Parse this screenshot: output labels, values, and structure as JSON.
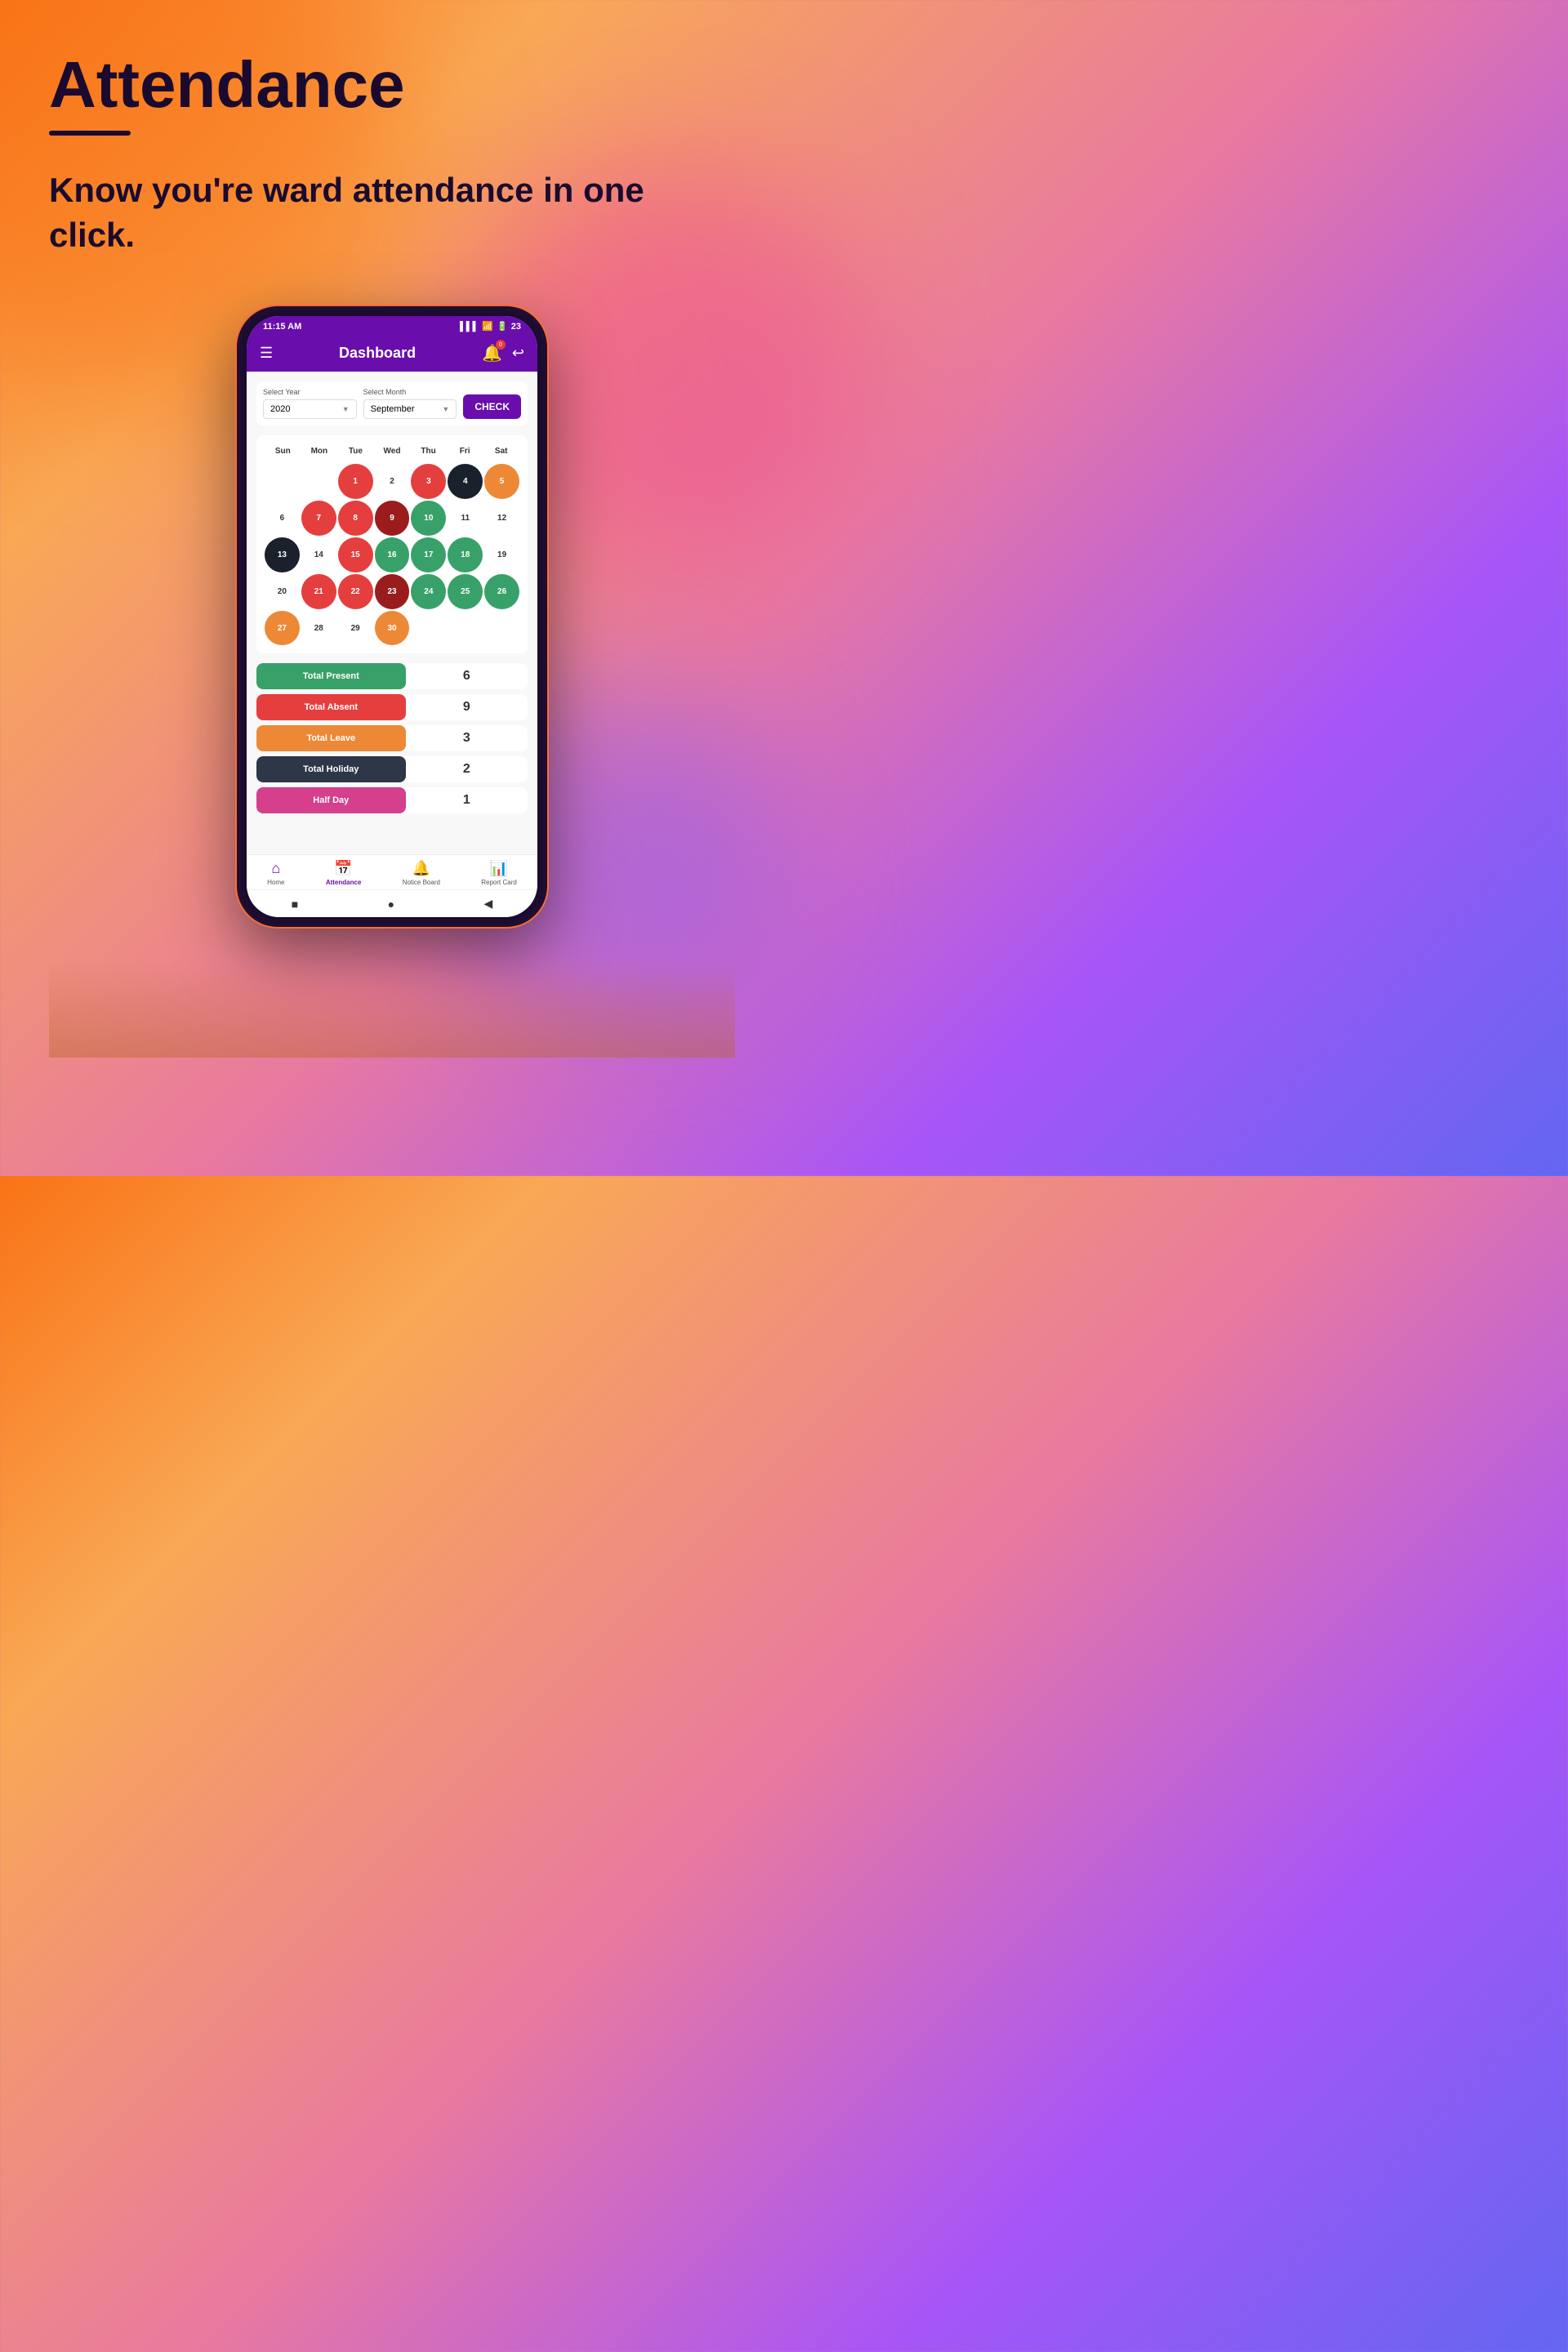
{
  "page": {
    "title": "Attendance",
    "subtitle": "Know you're ward attendance in one click.",
    "background_gradient": "linear-gradient(135deg, #f97316, #ec4899, #8b5cf6)"
  },
  "phone": {
    "status_bar": {
      "time": "11:15 AM",
      "battery": "23",
      "signal_bars": "|||",
      "wifi": "wifi"
    },
    "header": {
      "title": "Dashboard",
      "menu_icon": "☰",
      "bell_icon": "🔔",
      "bell_badge": "0",
      "profile_icon": "↩"
    },
    "selectors": {
      "year_label": "Select Year",
      "year_value": "2020",
      "month_label": "Select Month",
      "month_value": "September",
      "check_button": "CHECK"
    },
    "calendar": {
      "day_labels": [
        "Sun",
        "Mon",
        "Tue",
        "Wed",
        "Thu",
        "Fri",
        "Sat"
      ],
      "weeks": [
        [
          {
            "day": "",
            "type": "empty"
          },
          {
            "day": "",
            "type": "empty"
          },
          {
            "day": "1",
            "type": "red"
          },
          {
            "day": "2",
            "type": "normal"
          },
          {
            "day": "3",
            "type": "red"
          },
          {
            "day": "4",
            "type": "today"
          },
          {
            "day": "5",
            "type": "orange"
          }
        ],
        [
          {
            "day": "6",
            "type": "normal"
          },
          {
            "day": "7",
            "type": "red"
          },
          {
            "day": "8",
            "type": "red"
          },
          {
            "day": "9",
            "type": "dark-red"
          },
          {
            "day": "10",
            "type": "green"
          },
          {
            "day": "11",
            "type": "normal"
          },
          {
            "day": "12",
            "type": "normal"
          }
        ],
        [
          {
            "day": "13",
            "type": "black-circle"
          },
          {
            "day": "14",
            "type": "normal"
          },
          {
            "day": "15",
            "type": "red"
          },
          {
            "day": "16",
            "type": "green"
          },
          {
            "day": "17",
            "type": "green"
          },
          {
            "day": "18",
            "type": "green"
          },
          {
            "day": "19",
            "type": "normal"
          }
        ],
        [
          {
            "day": "20",
            "type": "normal"
          },
          {
            "day": "21",
            "type": "red"
          },
          {
            "day": "22",
            "type": "red"
          },
          {
            "day": "23",
            "type": "dark-red"
          },
          {
            "day": "24",
            "type": "green"
          },
          {
            "day": "25",
            "type": "green"
          },
          {
            "day": "26",
            "type": "green"
          }
        ],
        [
          {
            "day": "27",
            "type": "orange"
          },
          {
            "day": "28",
            "type": "normal"
          },
          {
            "day": "29",
            "type": "normal"
          },
          {
            "day": "30",
            "type": "orange"
          },
          {
            "day": "",
            "type": "empty"
          },
          {
            "day": "",
            "type": "empty"
          },
          {
            "day": "",
            "type": "empty"
          }
        ]
      ]
    },
    "stats": [
      {
        "label": "Total Present",
        "value": "6",
        "color_class": "stat-green"
      },
      {
        "label": "Total Absent",
        "value": "9",
        "color_class": "stat-red"
      },
      {
        "label": "Total Leave",
        "value": "3",
        "color_class": "stat-orange"
      },
      {
        "label": "Total Holiday",
        "value": "2",
        "color_class": "stat-dark"
      },
      {
        "label": "Half Day",
        "value": "1",
        "color_class": "stat-pink"
      }
    ],
    "bottom_nav": [
      {
        "label": "Home",
        "icon": "⌂",
        "active": false
      },
      {
        "label": "Attendance",
        "icon": "📅",
        "active": true
      },
      {
        "label": "Notice Board",
        "icon": "🔔",
        "active": false
      },
      {
        "label": "Report Card",
        "icon": "📊",
        "active": false
      }
    ],
    "android_nav": [
      "■",
      "●",
      "◀"
    ]
  }
}
